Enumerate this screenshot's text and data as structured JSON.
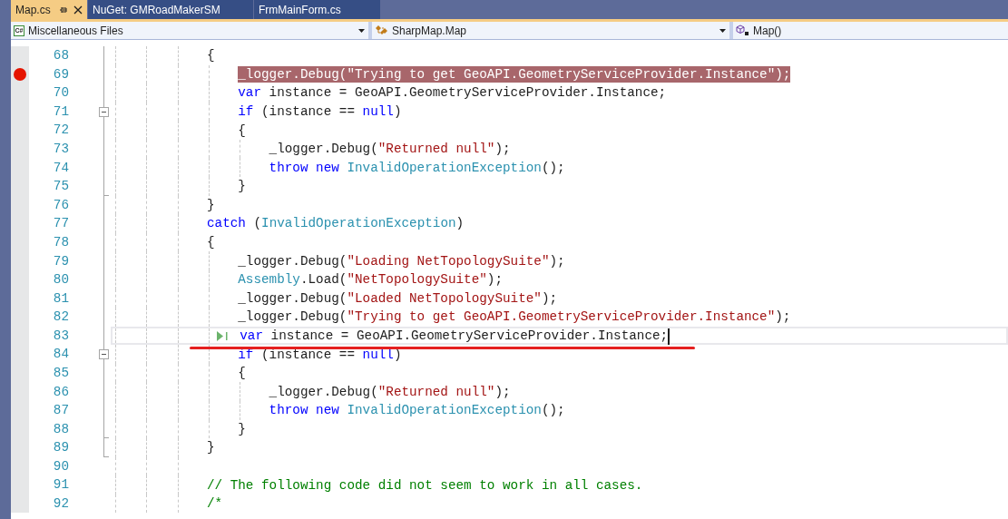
{
  "tabs": [
    {
      "label": "Map.cs",
      "selected": true,
      "pinned": true
    },
    {
      "label": "NuGet: GMRoadMakerSM",
      "selected": false,
      "pinned": false
    },
    {
      "label": "FrmMainForm.cs",
      "selected": false,
      "pinned": false
    }
  ],
  "navigation_bar": [
    {
      "kind": "project",
      "icon_label": "C#",
      "text": "Miscellaneous Files",
      "dropdown": true
    },
    {
      "kind": "class",
      "text": "SharpMap.Map",
      "dropdown": true
    },
    {
      "kind": "method",
      "text": "Map()",
      "dropdown": false
    }
  ],
  "editor": {
    "lines": [
      {
        "number": "68",
        "breakpoint": false,
        "current": false,
        "tokens": [
          {
            "kind": "plain",
            "text": "            {"
          }
        ]
      },
      {
        "number": "69",
        "breakpoint": true,
        "current": false,
        "tokens": [
          {
            "kind": "plain",
            "text": "                _logger.Debug("
          },
          {
            "kind": "string",
            "text": "\"Trying to get GeoAPI.GeometryServiceProvider.Instance\""
          },
          {
            "kind": "plain",
            "text": ");"
          }
        ]
      },
      {
        "number": "70",
        "breakpoint": false,
        "current": false,
        "tokens": [
          {
            "kind": "keyword",
            "text": "                var"
          },
          {
            "kind": "plain",
            "text": " instance = GeoAPI.GeometryServiceProvider.Instance;"
          }
        ]
      },
      {
        "number": "71",
        "breakpoint": false,
        "current": false,
        "collapsible": true,
        "tokens": [
          {
            "kind": "keyword",
            "text": "                if"
          },
          {
            "kind": "plain",
            "text": " (instance == "
          },
          {
            "kind": "keyword",
            "text": "null"
          },
          {
            "kind": "plain",
            "text": ")"
          }
        ]
      },
      {
        "number": "72",
        "breakpoint": false,
        "current": false,
        "tokens": [
          {
            "kind": "plain",
            "text": "                {"
          }
        ]
      },
      {
        "number": "73",
        "breakpoint": false,
        "current": false,
        "tokens": [
          {
            "kind": "plain",
            "text": "                    _logger.Debug("
          },
          {
            "kind": "string",
            "text": "\"Returned null\""
          },
          {
            "kind": "plain",
            "text": ");"
          }
        ]
      },
      {
        "number": "74",
        "breakpoint": false,
        "current": false,
        "tokens": [
          {
            "kind": "keyword",
            "text": "                    throw new"
          },
          {
            "kind": "type",
            "text": " InvalidOperationException"
          },
          {
            "kind": "plain",
            "text": "();"
          }
        ]
      },
      {
        "number": "75",
        "breakpoint": false,
        "current": false,
        "block_end": true,
        "tokens": [
          {
            "kind": "plain",
            "text": "                }"
          }
        ]
      },
      {
        "number": "76",
        "breakpoint": false,
        "current": false,
        "tokens": [
          {
            "kind": "plain",
            "text": "            }"
          }
        ]
      },
      {
        "number": "77",
        "breakpoint": false,
        "current": false,
        "tokens": [
          {
            "kind": "keyword",
            "text": "            catch"
          },
          {
            "kind": "plain",
            "text": " ("
          },
          {
            "kind": "type",
            "text": "InvalidOperationException"
          },
          {
            "kind": "plain",
            "text": ")"
          }
        ]
      },
      {
        "number": "78",
        "breakpoint": false,
        "current": false,
        "tokens": [
          {
            "kind": "plain",
            "text": "            {"
          }
        ]
      },
      {
        "number": "79",
        "breakpoint": false,
        "current": false,
        "tokens": [
          {
            "kind": "plain",
            "text": "                _logger.Debug("
          },
          {
            "kind": "string",
            "text": "\"Loading NetTopologySuite\""
          },
          {
            "kind": "plain",
            "text": ");"
          }
        ]
      },
      {
        "number": "80",
        "breakpoint": false,
        "current": false,
        "tokens": [
          {
            "kind": "type",
            "text": "                Assembly"
          },
          {
            "kind": "plain",
            "text": ".Load("
          },
          {
            "kind": "string",
            "text": "\"NetTopologySuite\""
          },
          {
            "kind": "plain",
            "text": ");"
          }
        ]
      },
      {
        "number": "81",
        "breakpoint": false,
        "current": false,
        "tokens": [
          {
            "kind": "plain",
            "text": "                _logger.Debug("
          },
          {
            "kind": "string",
            "text": "\"Loaded NetTopologySuite\""
          },
          {
            "kind": "plain",
            "text": ");"
          }
        ]
      },
      {
        "number": "82",
        "breakpoint": false,
        "current": false,
        "tokens": [
          {
            "kind": "plain",
            "text": "                _logger.Debug("
          },
          {
            "kind": "string",
            "text": "\"Trying to get GeoAPI.GeometryServiceProvider.Instance\""
          },
          {
            "kind": "plain",
            "text": ");"
          }
        ]
      },
      {
        "number": "83",
        "breakpoint": false,
        "current": true,
        "tokens": [
          {
            "kind": "keyword",
            "text": "                var"
          },
          {
            "kind": "plain",
            "text": " instance = GeoAPI.GeometryServiceProvider.Instance;"
          }
        ]
      },
      {
        "number": "84",
        "breakpoint": false,
        "current": false,
        "collapsible": true,
        "tokens": [
          {
            "kind": "keyword",
            "text": "                if"
          },
          {
            "kind": "plain",
            "text": " (instance == "
          },
          {
            "kind": "keyword",
            "text": "null"
          },
          {
            "kind": "plain",
            "text": ")"
          }
        ]
      },
      {
        "number": "85",
        "breakpoint": false,
        "current": false,
        "tokens": [
          {
            "kind": "plain",
            "text": "                {"
          }
        ]
      },
      {
        "number": "86",
        "breakpoint": false,
        "current": false,
        "tokens": [
          {
            "kind": "plain",
            "text": "                    _logger.Debug("
          },
          {
            "kind": "string",
            "text": "\"Returned null\""
          },
          {
            "kind": "plain",
            "text": ");"
          }
        ]
      },
      {
        "number": "87",
        "breakpoint": false,
        "current": false,
        "tokens": [
          {
            "kind": "keyword",
            "text": "                    throw new"
          },
          {
            "kind": "type",
            "text": " InvalidOperationException"
          },
          {
            "kind": "plain",
            "text": "();"
          }
        ]
      },
      {
        "number": "88",
        "breakpoint": false,
        "current": false,
        "block_end": true,
        "tokens": [
          {
            "kind": "plain",
            "text": "                }"
          }
        ]
      },
      {
        "number": "89",
        "breakpoint": false,
        "current": false,
        "block_end": true,
        "tokens": [
          {
            "kind": "plain",
            "text": "            }"
          }
        ]
      },
      {
        "number": "90",
        "breakpoint": false,
        "current": false
      },
      {
        "number": "91",
        "breakpoint": false,
        "current": false,
        "tokens": [
          {
            "kind": "comment",
            "text": "            // The following code did not seem to work in all cases."
          }
        ]
      },
      {
        "number": "92",
        "breakpoint": false,
        "current": false,
        "tokens": [
          {
            "kind": "comment",
            "text": "            /*"
          }
        ]
      }
    ],
    "annotation": {
      "kind": "underline"
    }
  }
}
